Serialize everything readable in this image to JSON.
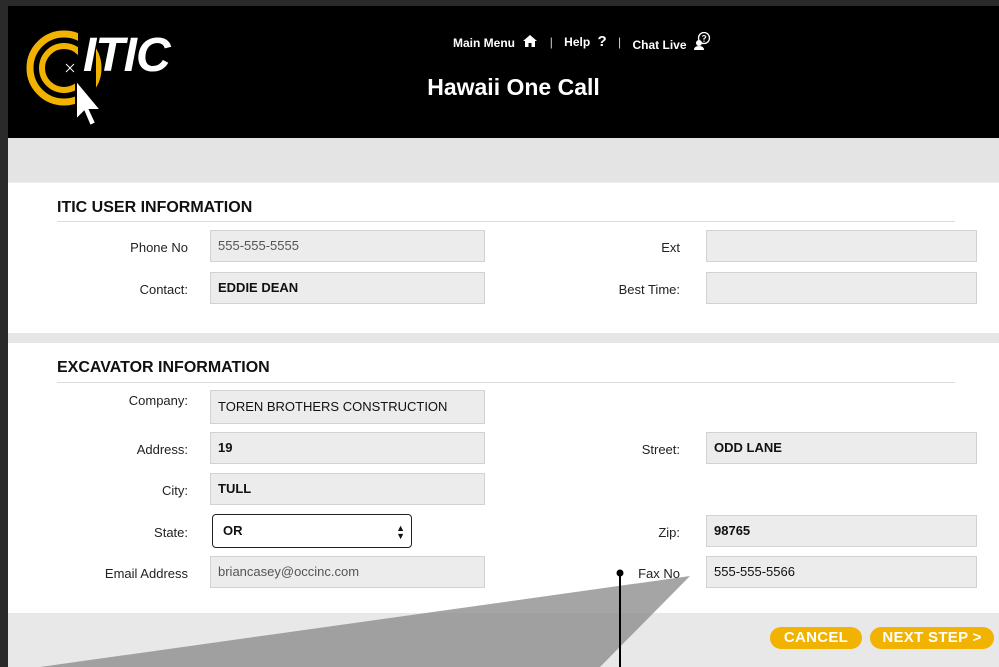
{
  "header": {
    "logo_text": "ITIC",
    "nav": {
      "main_menu": "Main Menu",
      "help": "Help",
      "help_glyph": "?",
      "chat_live": "Chat Live"
    },
    "title": "Hawaii One Call"
  },
  "user_info": {
    "title": "ITIC USER INFORMATION",
    "phone_label": "Phone No",
    "phone_value": "555-555-5555",
    "ext_label": "Ext",
    "ext_value": "",
    "contact_label": "Contact:",
    "contact_value": "EDDIE DEAN",
    "best_time_label": "Best Time:",
    "best_time_value": ""
  },
  "excavator_info": {
    "title": "EXCAVATOR INFORMATION",
    "company_label": "Company:",
    "company_value": "TOREN BROTHERS CONSTRUCTION",
    "address_label": "Address:",
    "address_value": "19",
    "street_label": "Street:",
    "street_value": "ODD LANE",
    "city_label": "City:",
    "city_value": "TULL",
    "state_label": "State:",
    "state_value": "OR",
    "zip_label": "Zip:",
    "zip_value": "98765",
    "email_label": "Email Address",
    "email_value": "briancasey@occinc.com",
    "fax_label": "Fax No",
    "fax_value": "555-555-5566"
  },
  "actions": {
    "cancel": "CANCEL",
    "next_step": "NEXT STEP >"
  },
  "colors": {
    "header_bg": "#000000",
    "accent": "#f2b300",
    "field_bg": "#ececec"
  },
  "icons": [
    "home-icon",
    "chat-support-icon",
    "cursor-logo-icon",
    "chevron-updown-icon"
  ]
}
